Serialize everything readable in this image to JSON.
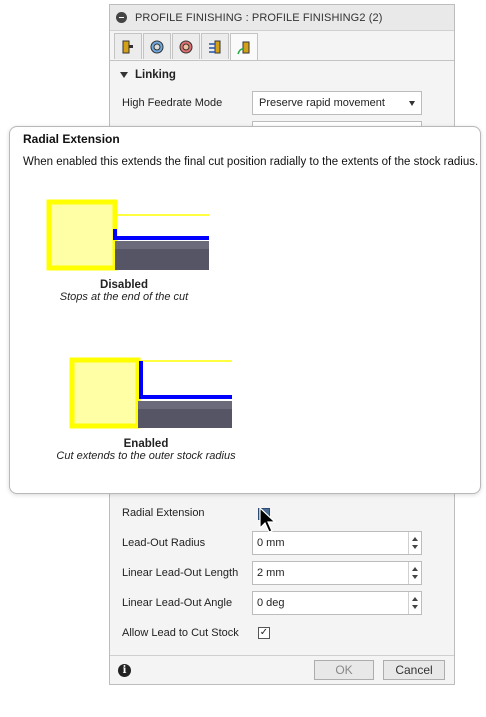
{
  "window": {
    "title": "PROFILE FINISHING : PROFILE FINISHING2 (2)"
  },
  "tabs": [
    {
      "icon": "tool-icon"
    },
    {
      "icon": "geometry-icon"
    },
    {
      "icon": "heights-icon"
    },
    {
      "icon": "passes-icon"
    },
    {
      "icon": "linking-icon",
      "active": true
    }
  ],
  "linking": {
    "section_label": "Linking",
    "high_feedrate_mode": {
      "label": "High Feedrate Mode",
      "value": "Preserve rapid movement"
    }
  },
  "tooltip": {
    "title": "Radial Extension",
    "description": "When enabled this extends the final cut position radially to the extents of the stock radius.",
    "disabled": {
      "title": "Disabled",
      "subtitle": "Stops at the end of the cut"
    },
    "enabled": {
      "title": "Enabled",
      "subtitle": "Cut extends to the outer stock radius"
    }
  },
  "fields": {
    "radial_extension": {
      "label": "Radial Extension"
    },
    "lead_out_radius": {
      "label": "Lead-Out Radius",
      "value": "0 mm"
    },
    "linear_lead_out_length": {
      "label": "Linear Lead-Out Length",
      "value": "2 mm"
    },
    "linear_lead_out_angle": {
      "label": "Linear Lead-Out Angle",
      "value": "0 deg"
    },
    "allow_lead_to_cut_stock": {
      "label": "Allow Lead to Cut Stock",
      "checked": true,
      "mark": "✓"
    }
  },
  "footer": {
    "ok": "OK",
    "cancel": "Cancel",
    "info": "i"
  },
  "colors": {
    "yellow": "#ffff00",
    "blue": "#0000ff",
    "stock": "#555566",
    "pale_yellow": "#ffffa6"
  }
}
